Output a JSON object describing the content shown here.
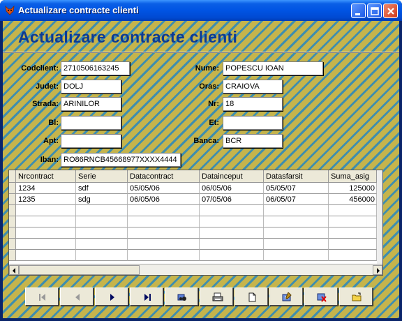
{
  "window": {
    "title": "Actualizare contracte clienti"
  },
  "header": {
    "title": "Actualizare contracte clienti"
  },
  "form": {
    "codclient": {
      "label": "Codclient:",
      "value": "2710506163245"
    },
    "nume": {
      "label": "Nume:",
      "value": "POPESCU IOAN"
    },
    "judet": {
      "label": "Judet:",
      "value": "DOLJ"
    },
    "oras": {
      "label": "Oras:",
      "value": "CRAIOVA"
    },
    "strada": {
      "label": "Strada:",
      "value": "ARINILOR"
    },
    "nr": {
      "label": "Nr:",
      "value": "18"
    },
    "bl": {
      "label": "Bl:",
      "value": ""
    },
    "et": {
      "label": "Et:",
      "value": ""
    },
    "apt": {
      "label": "Apt:",
      "value": ""
    },
    "banca": {
      "label": "Banca:",
      "value": "BCR"
    },
    "iban": {
      "label": "Iban:",
      "value": "RO86RNCB45668977XXXX4444"
    }
  },
  "grid": {
    "columns": [
      "Nrcontract",
      "Serie",
      "Datacontract",
      "Datainceput",
      "Datasfarsit",
      "Suma_asig"
    ],
    "rows": [
      [
        "1234",
        "sdf",
        "05/05/06",
        "06/05/06",
        "05/05/07",
        "125000"
      ],
      [
        "1235",
        "sdg",
        "06/05/06",
        "07/05/06",
        "06/05/07",
        "456000"
      ]
    ]
  },
  "toolbar": {
    "icons": [
      "first-record-icon",
      "previous-record-icon",
      "next-record-icon",
      "last-record-icon",
      "find-icon",
      "print-icon",
      "new-record-icon",
      "edit-record-icon",
      "delete-record-icon",
      "exit-icon"
    ]
  },
  "colors": {
    "accent": "#0c3a94",
    "background": "#c5b44c",
    "stripe": "#3f8eae",
    "titlebar": "#0054e3"
  }
}
